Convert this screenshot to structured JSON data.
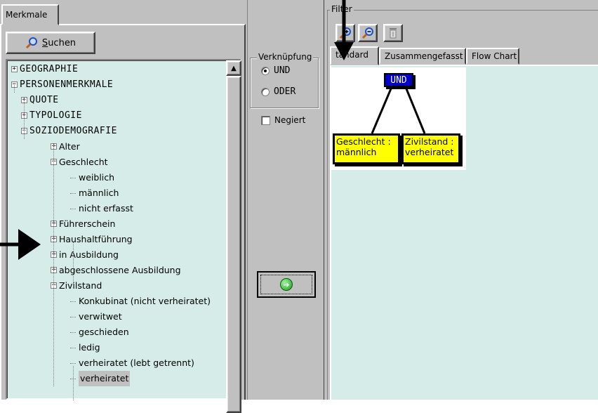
{
  "left": {
    "tab_label": "Merkmale",
    "search_button": {
      "accel": "S",
      "rest": "uchen"
    },
    "tree": [
      {
        "label": "GEOGRAPHIE",
        "depth": 0,
        "expander": "+",
        "upper": true
      },
      {
        "label": "PERSONENMERKMALE",
        "depth": 0,
        "expander": "−",
        "upper": true
      },
      {
        "label": "QUOTE",
        "depth": 1,
        "expander": "+",
        "upper": true
      },
      {
        "label": "TYPOLOGIE",
        "depth": 1,
        "expander": "+",
        "upper": true
      },
      {
        "label": "SOZIODEMOGRAFIE",
        "depth": 1,
        "expander": "−",
        "upper": true
      },
      {
        "label": "Alter",
        "depth": 2,
        "expander": "+"
      },
      {
        "label": "Geschlecht",
        "depth": 2,
        "expander": "−"
      },
      {
        "label": "weiblich",
        "depth": 3,
        "expander": ""
      },
      {
        "label": "männlich",
        "depth": 3,
        "expander": ""
      },
      {
        "label": "nicht erfasst",
        "depth": 3,
        "expander": ""
      },
      {
        "label": "Führerschein",
        "depth": 2,
        "expander": "+"
      },
      {
        "label": "Haushaltführung",
        "depth": 2,
        "expander": "+"
      },
      {
        "label": "in Ausbildung",
        "depth": 2,
        "expander": "+"
      },
      {
        "label": "abgeschlossene Ausbildung",
        "depth": 2,
        "expander": "+"
      },
      {
        "label": "Zivilstand",
        "depth": 2,
        "expander": "−"
      },
      {
        "label": "Konkubinat (nicht verheiratet)",
        "depth": 3,
        "expander": ""
      },
      {
        "label": "verwitwet",
        "depth": 3,
        "expander": ""
      },
      {
        "label": "geschieden",
        "depth": 3,
        "expander": ""
      },
      {
        "label": "ledig",
        "depth": 3,
        "expander": ""
      },
      {
        "label": "verheiratet (lebt getrennt)",
        "depth": 3,
        "expander": ""
      },
      {
        "label": "verheiratet",
        "depth": 3,
        "expander": "",
        "selected": true
      }
    ]
  },
  "middle": {
    "group_label": "Verknüpfung",
    "radio_und": "UND",
    "radio_oder": "ODER",
    "selected": "UND",
    "negiert_label": "Negiert",
    "negiert_checked": false
  },
  "right": {
    "filter_label": "Filter",
    "toolbar": [
      "zoom-in-icon",
      "zoom-out-icon",
      "delete-icon"
    ],
    "tabs": [
      "Standard",
      "Zusammengefasst",
      "Flow Chart"
    ],
    "tab_visible": [
      "tandard",
      "Zusammengefasst",
      "Flow Chart"
    ],
    "active_tab": "Standard",
    "diagram": {
      "root": "UND",
      "left_leaf_line1": "Geschlecht :",
      "left_leaf_line2": "männlich",
      "right_leaf_line1": "Zivilstand :",
      "right_leaf_line2": "verheiratet"
    }
  },
  "colors": {
    "face": "#c0c0c0",
    "tree_bg": "#d6ece9",
    "root_node": "#0000c8",
    "leaf_node": "#ffff00"
  }
}
